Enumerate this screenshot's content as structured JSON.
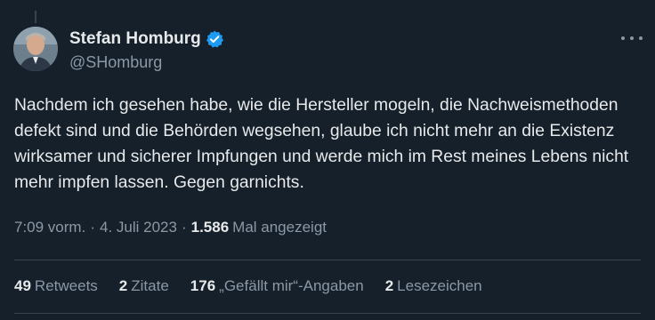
{
  "author": {
    "display_name": "Stefan Homburg",
    "handle": "@SHomburg",
    "verified": true
  },
  "tweet": {
    "text": "Nachdem ich gesehen habe, wie die Hersteller mogeln, die Nachweismethoden defekt sind und die Behörden wegsehen, glaube ich nicht mehr an die Existenz wirksamer und sicherer Impfungen und werde mich im Rest meines Lebens nicht mehr impfen lassen. Gegen garnichts."
  },
  "meta": {
    "time": "7:09 vorm.",
    "separator": "·",
    "date": "4. Juli 2023",
    "views_count": "1.586",
    "views_label": "Mal angezeigt"
  },
  "stats": {
    "retweets_count": "49",
    "retweets_label": "Retweets",
    "quotes_count": "2",
    "quotes_label": "Zitate",
    "likes_count": "176",
    "likes_label": "„Gefällt mir“-Angaben",
    "bookmarks_count": "2",
    "bookmarks_label": "Lesezeichen"
  },
  "icons": {
    "verified": "verified-badge-icon",
    "more": "more-horizontal-icon"
  },
  "colors": {
    "background": "#15202b",
    "text_primary": "#e7e9ea",
    "text_secondary": "#8b98a5",
    "divider": "#38444d",
    "verified": "#1d9bf0"
  }
}
